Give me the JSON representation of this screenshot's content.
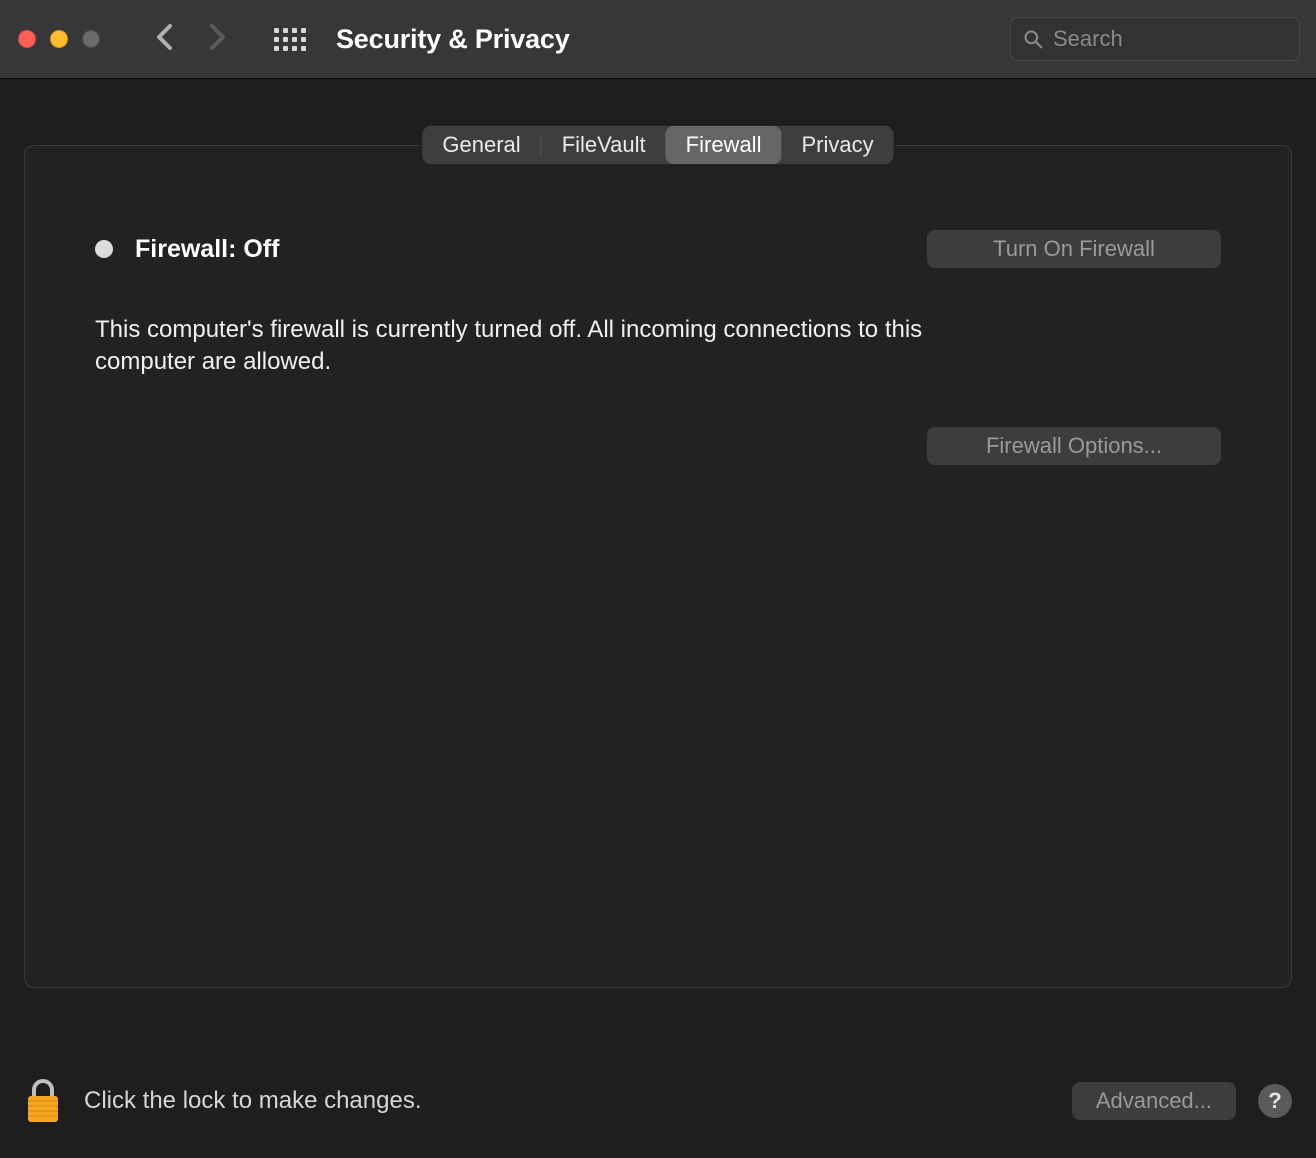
{
  "window": {
    "title": "Security & Privacy"
  },
  "search": {
    "placeholder": "Search",
    "value": ""
  },
  "tabs": {
    "items": [
      {
        "label": "General"
      },
      {
        "label": "FileVault"
      },
      {
        "label": "Firewall"
      },
      {
        "label": "Privacy"
      }
    ],
    "active_index": 2
  },
  "firewall": {
    "status_label": "Firewall: Off",
    "turn_on_label": "Turn On Firewall",
    "description": "This computer's firewall is currently turned off. All incoming connections to this computer are allowed.",
    "options_label": "Firewall Options..."
  },
  "footer": {
    "lock_hint": "Click the lock to make changes.",
    "advanced_label": "Advanced...",
    "help_label": "?"
  }
}
